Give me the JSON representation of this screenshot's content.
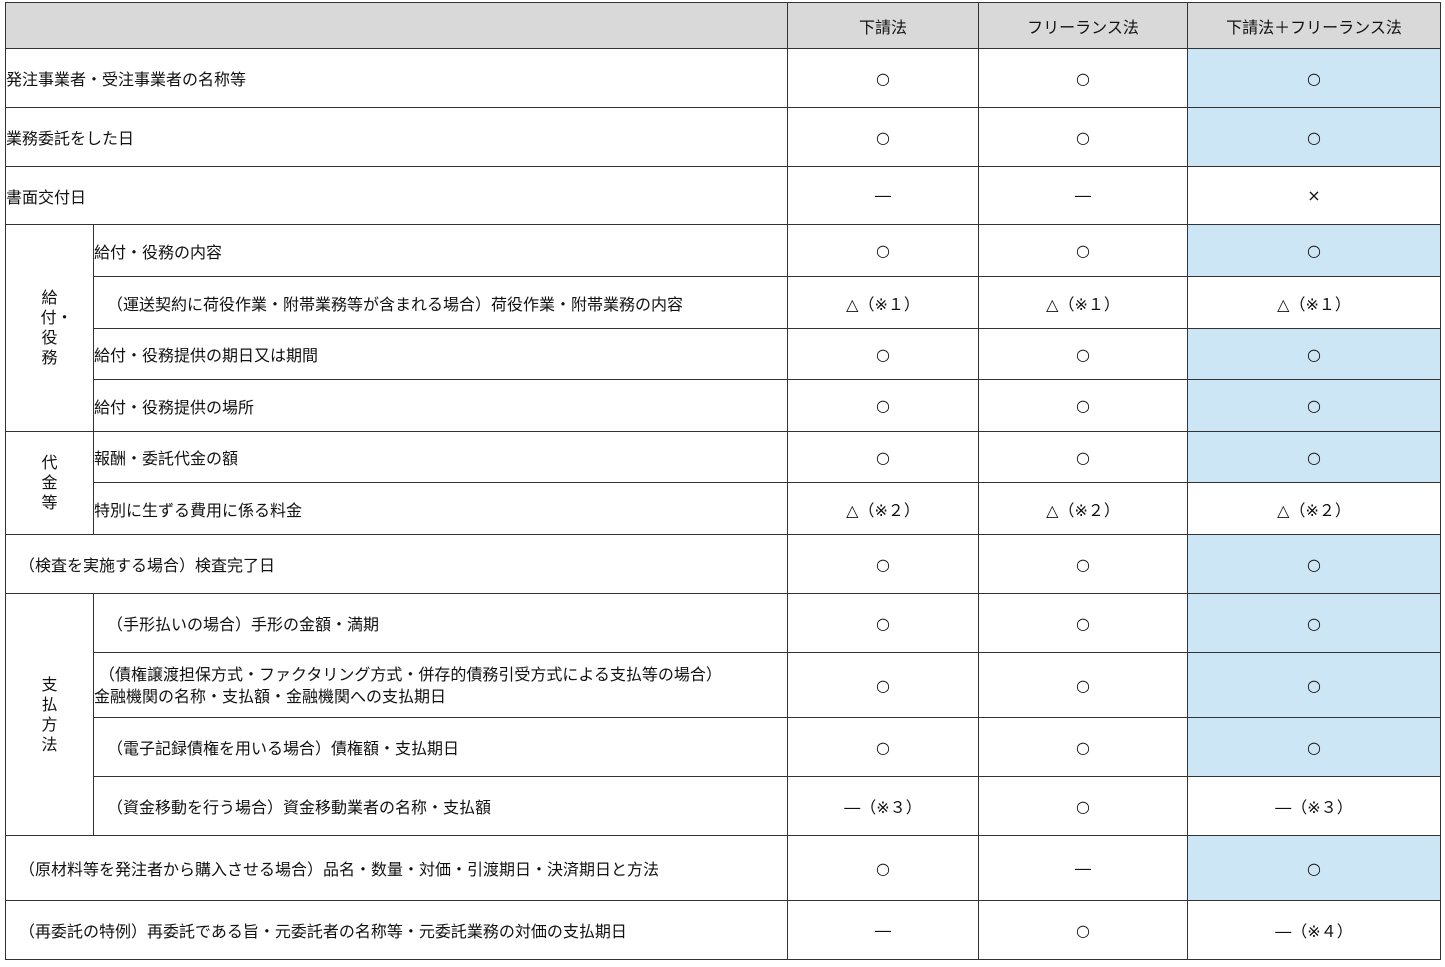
{
  "headers": [
    "下請法",
    "フリーランス法",
    "下請法＋フリーランス法"
  ],
  "groups": {
    "kyufu": "給付・役務",
    "daikin": "代金等",
    "shiharai": "支払方法"
  },
  "rows": [
    {
      "label": "発注事業者・受注事業者の名称等",
      "values": [
        "○",
        "○",
        "○"
      ]
    },
    {
      "label": "業務委託をした日",
      "values": [
        "○",
        "○",
        "○"
      ]
    },
    {
      "label": "書面交付日",
      "values": [
        "―",
        "―",
        "×"
      ]
    },
    {
      "label": "給付・役務の内容",
      "values": [
        "○",
        "○",
        "○"
      ]
    },
    {
      "label": "（運送契約に荷役作業・附帯業務等が含まれる場合）荷役作業・附帯業務の内容",
      "values": [
        "△（※１）",
        "△（※１）",
        "△（※１）"
      ]
    },
    {
      "label": "給付・役務提供の期日又は期間",
      "values": [
        "○",
        "○",
        "○"
      ]
    },
    {
      "label": "給付・役務提供の場所",
      "values": [
        "○",
        "○",
        "○"
      ]
    },
    {
      "label": "報酬・委託代金の額",
      "values": [
        "○",
        "○",
        "○"
      ]
    },
    {
      "label": "特別に生ずる費用に係る料金",
      "values": [
        "△（※２）",
        "△（※２）",
        "△（※２）"
      ]
    },
    {
      "label": "（検査を実施する場合）検査完了日",
      "values": [
        "○",
        "○",
        "○"
      ]
    },
    {
      "label": "（手形払いの場合）手形の金額・満期",
      "values": [
        "○",
        "○",
        "○"
      ]
    },
    {
      "label": "（債権譲渡担保方式・ファクタリング方式・併存的債務引受方式による支払等の場合）",
      "label2": "金融機関の名称・支払額・金融機関への支払期日",
      "values": [
        "○",
        "○",
        "○"
      ]
    },
    {
      "label": "（電子記録債権を用いる場合）債権額・支払期日",
      "values": [
        "○",
        "○",
        "○"
      ]
    },
    {
      "label": "（資金移動を行う場合）資金移動業者の名称・支払額",
      "values": [
        "―（※３）",
        "○",
        "―（※３）"
      ]
    },
    {
      "label": "（原材料等を発注者から購入させる場合）品名・数量・対価・引渡期日・決済期日と方法",
      "values": [
        "○",
        "―",
        "○"
      ]
    },
    {
      "label": "（再委託の特例）再委託である旨・元委託者の名称等・元委託業務の対価の支払期日",
      "values": [
        "―",
        "○",
        "―（※４）"
      ]
    }
  ],
  "highlight_color": "#cde6f5",
  "header_color": "#d9d9d9"
}
